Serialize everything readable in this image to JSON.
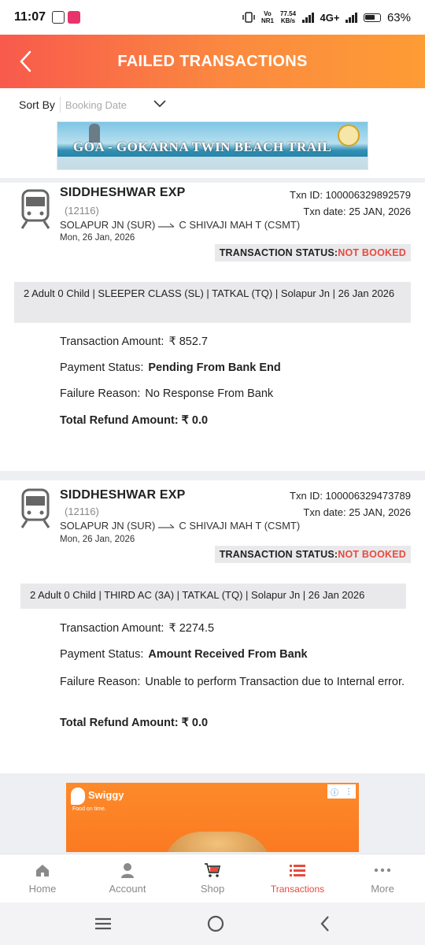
{
  "status_bar": {
    "time": "11:07",
    "net_speed": "77.54",
    "net_unit": "KB/s",
    "volte": "Vo",
    "nr": "NR1",
    "network": "4G+",
    "battery": "63%"
  },
  "header": {
    "title": "FAILED TRANSACTIONS"
  },
  "sort": {
    "label": "Sort By",
    "value": "Booking Date"
  },
  "banner": {
    "title": "GOA - GOKARNA TWIN BEACH TRAIL"
  },
  "transactions": [
    {
      "train_name": "SIDDHESHWAR EXP",
      "train_no": "(12116)",
      "from": "SOLAPUR JN (SUR)",
      "to": "C SHIVAJI MAH T (CSMT)",
      "journey_date": "Mon, 26 Jan, 2026",
      "txn_id": "Txn ID: 100006329892579",
      "txn_date": "Txn date: 25 JAN, 2026",
      "status_label": "TRANSACTION STATUS:",
      "status_value": "NOT BOOKED",
      "info": "2 Adult 0 Child  | SLEEPER CLASS (SL) | TATKAL (TQ) | Solapur Jn | 26 Jan 2026",
      "amount_label": "Transaction Amount:",
      "amount_value": "₹  852.7",
      "payment_label": "Payment Status:",
      "payment_value": "Pending From Bank End",
      "failure_label": "Failure Reason:",
      "failure_value": "No Response From Bank",
      "refund": "Total Refund Amount: ₹ 0.0"
    },
    {
      "train_name": "SIDDHESHWAR EXP",
      "train_no": "(12116)",
      "from": "SOLAPUR JN (SUR)",
      "to": "C SHIVAJI MAH T (CSMT)",
      "journey_date": "Mon, 26 Jan, 2026",
      "txn_id": "Txn ID: 100006329473789",
      "txn_date": "Txn date: 25 JAN, 2026",
      "status_label": "TRANSACTION STATUS:",
      "status_value": "NOT BOOKED",
      "info": "2 Adult 0 Child  | THIRD AC (3A) | TATKAL (TQ) | Solapur Jn | 26 Jan 2026",
      "amount_label": "Transaction Amount:",
      "amount_value": "₹  2274.5",
      "payment_label": "Payment Status:",
      "payment_value": "Amount Received From Bank",
      "failure_label": "Failure Reason:",
      "failure_value": "Unable to perform Transaction due to Internal error.",
      "refund": "Total Refund Amount: ₹ 0.0"
    }
  ],
  "ad": {
    "brand": "Swiggy",
    "tagline": "Food on time."
  },
  "bottom_nav": [
    {
      "label": "Home",
      "icon": "home-icon"
    },
    {
      "label": "Account",
      "icon": "account-icon"
    },
    {
      "label": "Shop",
      "icon": "shop-cart-icon"
    },
    {
      "label": "Transactions",
      "icon": "transactions-list-icon",
      "active": true
    },
    {
      "label": "More",
      "icon": "more-dots-icon"
    }
  ],
  "colors": {
    "accent": "#e84a3c",
    "header_start": "#f85a4c",
    "header_end": "#fe9c35"
  }
}
